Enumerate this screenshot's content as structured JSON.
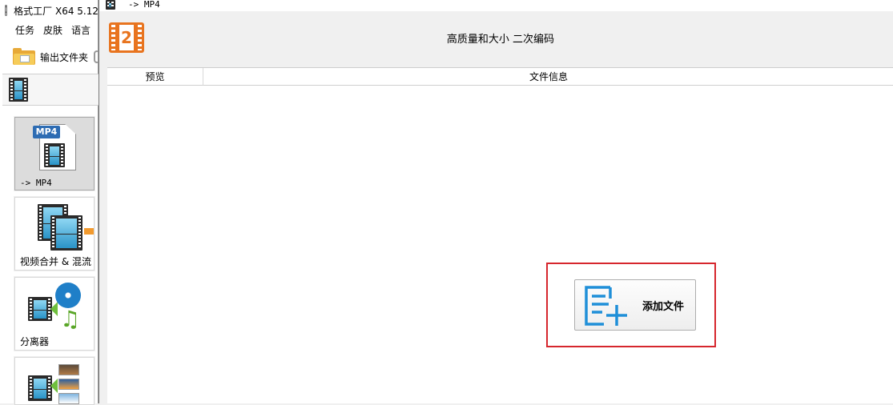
{
  "main_window": {
    "title": "格式工厂 X64 5.12",
    "menu": [
      "任务",
      "皮肤",
      "语言"
    ],
    "toolbar": {
      "output_folder_label": "输出文件夹"
    },
    "tiles": [
      {
        "label": "-> MP4",
        "badge": "MP4"
      },
      {
        "label": "视频合并 & 混流"
      },
      {
        "label": "分离器"
      },
      {
        "label": ""
      }
    ]
  },
  "dialog": {
    "title": "-> MP4",
    "header": {
      "icon_digit": "2",
      "subtitle": "高质量和大小  二次编码"
    },
    "columns": {
      "preview": "预览",
      "file_info": "文件信息"
    },
    "add_file_button": {
      "label": "添加文件"
    }
  },
  "colors": {
    "highlight": "#d6262d",
    "accent_orange": "#e8741f",
    "icon_blue": "#1f8fd8"
  }
}
